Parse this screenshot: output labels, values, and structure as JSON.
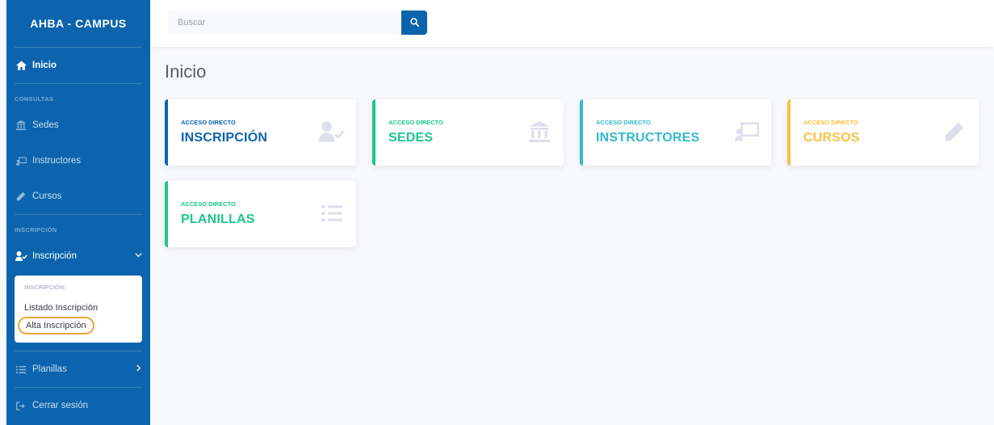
{
  "app": {
    "brand": "AHBA - CAMPUS"
  },
  "colors": {
    "primary": "#0b64ad",
    "success": "#1cc88a",
    "info": "#36b9cc",
    "warning": "#f6c23e",
    "icon_gray": "#dddfeb"
  },
  "sidebar": {
    "inicio": {
      "label": "Inicio",
      "icon": "home-icon"
    },
    "heading_consultas": "CONSULTAS",
    "sedes": {
      "label": "Sedes",
      "icon": "bank-icon"
    },
    "instructores": {
      "label": "Instructores",
      "icon": "chalkboard-teacher-icon"
    },
    "cursos": {
      "label": "Cursos",
      "icon": "pencil-icon"
    },
    "heading_inscripcion": "INSCRIPCIÓN",
    "inscripcion": {
      "label": "Inscripción",
      "icon": "user-check-icon",
      "submenu_heading": "INSCRIPCIÓN:",
      "items": [
        "Listado Inscripción",
        "Alta Inscripción"
      ]
    },
    "planillas": {
      "label": "Planillas",
      "icon": "tasks-icon"
    },
    "logout": {
      "label": "Cerrar sesión",
      "icon": "sign-out-icon"
    }
  },
  "topbar": {
    "search_placeholder": "Buscar",
    "search_icon": "search-icon"
  },
  "main": {
    "title": "Inicio",
    "cards": [
      {
        "kicker": "ACCESO DIRECTO",
        "label": "INSCRIPCIÓN",
        "color": "#0b64ad",
        "icon": "user-check-icon"
      },
      {
        "kicker": "ACCESO DIRECTO",
        "label": "SEDES",
        "color": "#1cc88a",
        "icon": "bank-icon"
      },
      {
        "kicker": "ACCESO DIRECTO",
        "label": "INSTRUCTORES",
        "color": "#36b9cc",
        "icon": "chalkboard-teacher-icon"
      },
      {
        "kicker": "ACCESO DIRECTO",
        "label": "CURSOS",
        "color": "#f6c23e",
        "icon": "pencil-icon"
      },
      {
        "kicker": "ACCESO DIRECTO",
        "label": "PLANILLAS",
        "color": "#1cc88a",
        "icon": "tasks-icon"
      }
    ]
  }
}
